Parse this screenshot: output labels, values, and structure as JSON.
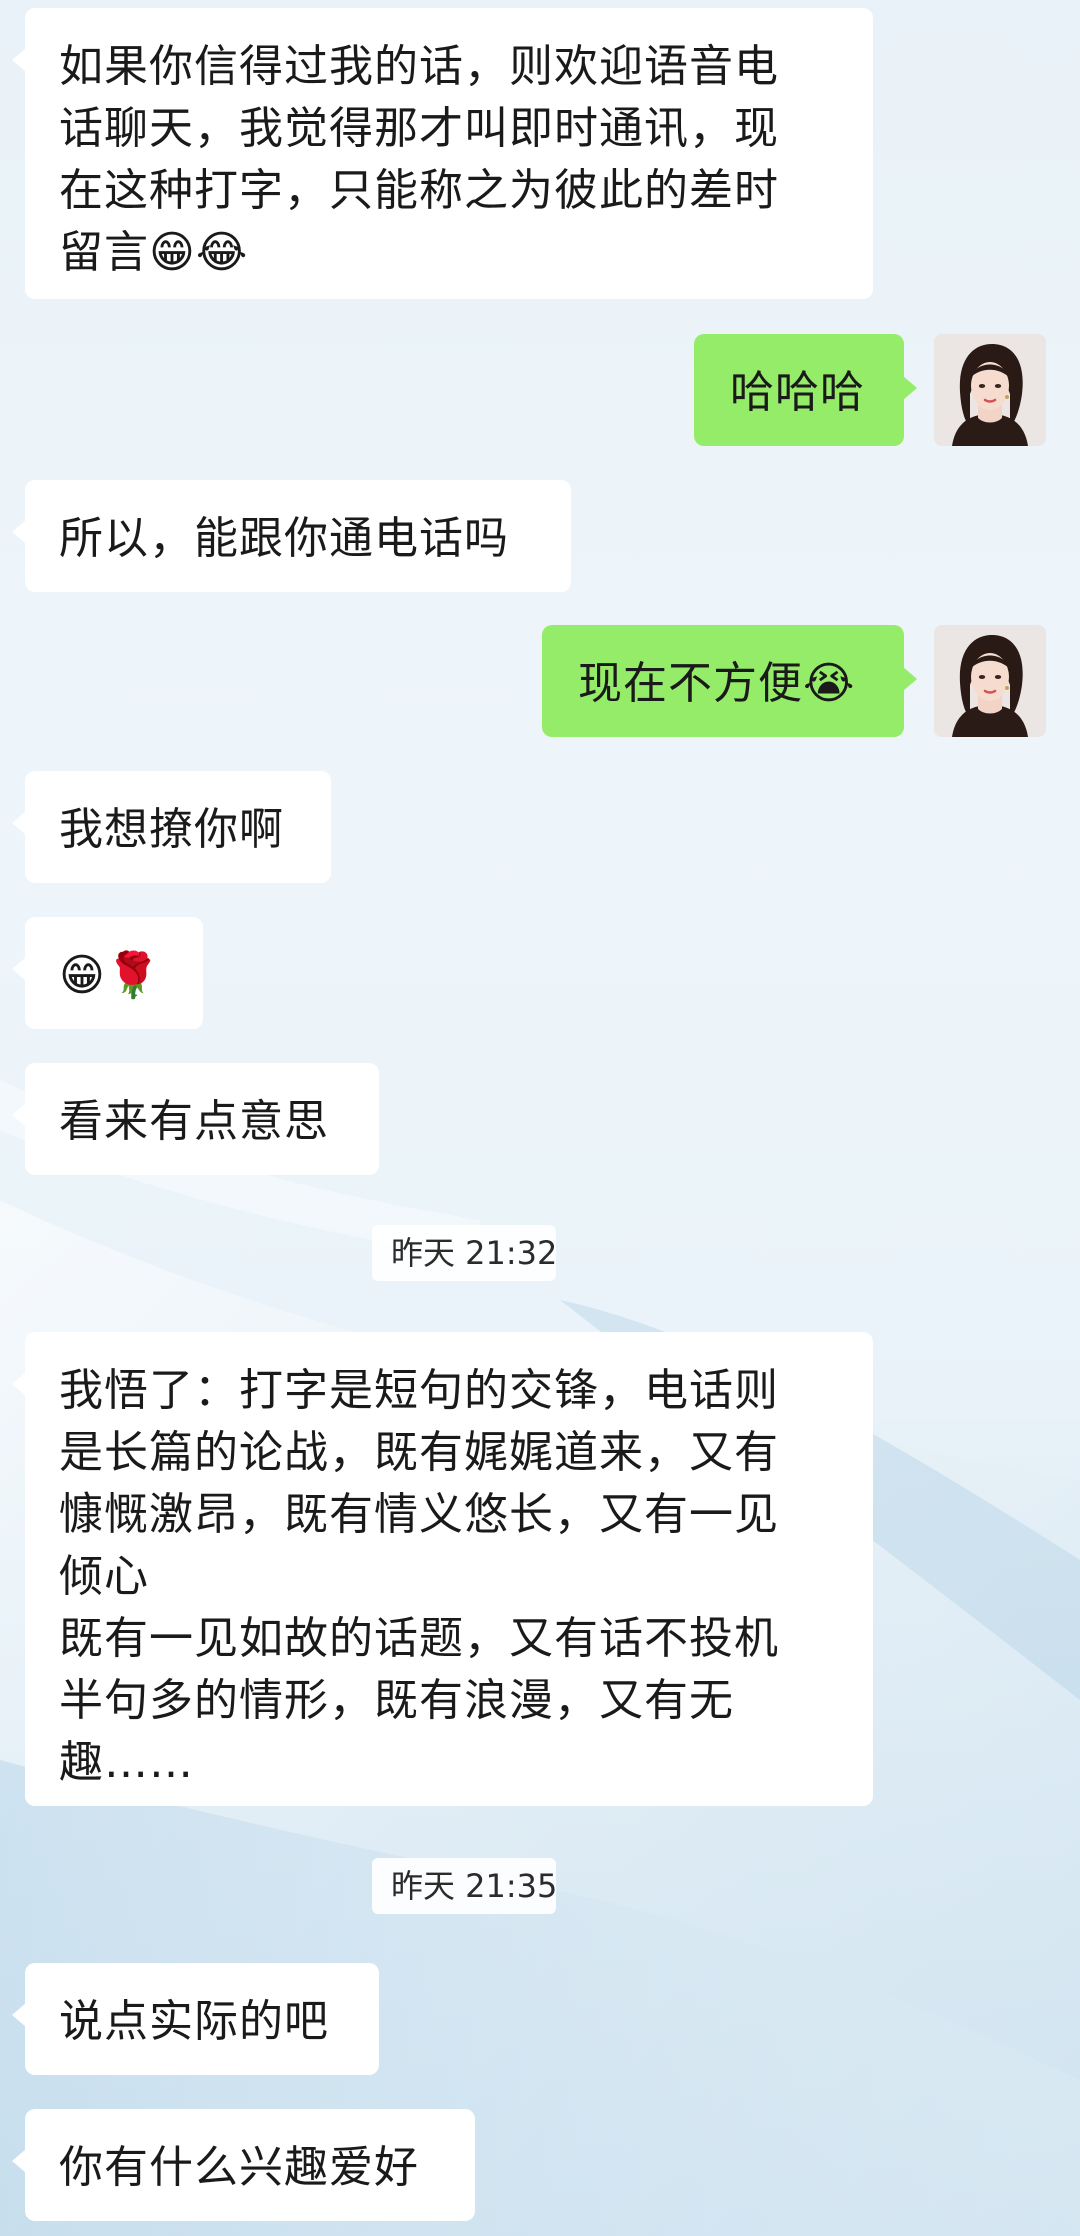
{
  "messages": [
    {
      "side": "in",
      "text": "如果你信得过我的话，则欢迎语音电\n话聊天，我觉得那才叫即时通讯，现\n在这种打字，只能称之为彼此的差时\n留言😁😂"
    },
    {
      "side": "out",
      "text": "哈哈哈"
    },
    {
      "side": "in",
      "text": "所以，能跟你通电话吗"
    },
    {
      "side": "out",
      "text": "现在不方便😭"
    },
    {
      "side": "in",
      "text": "我想撩你啊"
    },
    {
      "side": "in",
      "text": "😁🌹"
    },
    {
      "side": "in",
      "text": "看来有点意思"
    },
    {
      "side": "time",
      "text": "昨天 21:32"
    },
    {
      "side": "in",
      "text": "我悟了：打字是短句的交锋，电话则\n是长篇的论战，既有娓娓道来，又有\n慷慨激昂，既有情义悠长，又有一见\n倾心\n既有一见如故的话题，又有话不投机\n半句多的情形，既有浪漫，又有无\n趣……"
    },
    {
      "side": "time",
      "text": "昨天 21:35"
    },
    {
      "side": "in",
      "text": "说点实际的吧"
    },
    {
      "side": "in",
      "text": "你有什么兴趣爱好"
    }
  ],
  "colors": {
    "incoming_bubble": "#ffffff",
    "outgoing_bubble": "#95ec69",
    "text": "#1a1a1a"
  },
  "icons": {
    "avatar": "user-avatar-portrait"
  }
}
